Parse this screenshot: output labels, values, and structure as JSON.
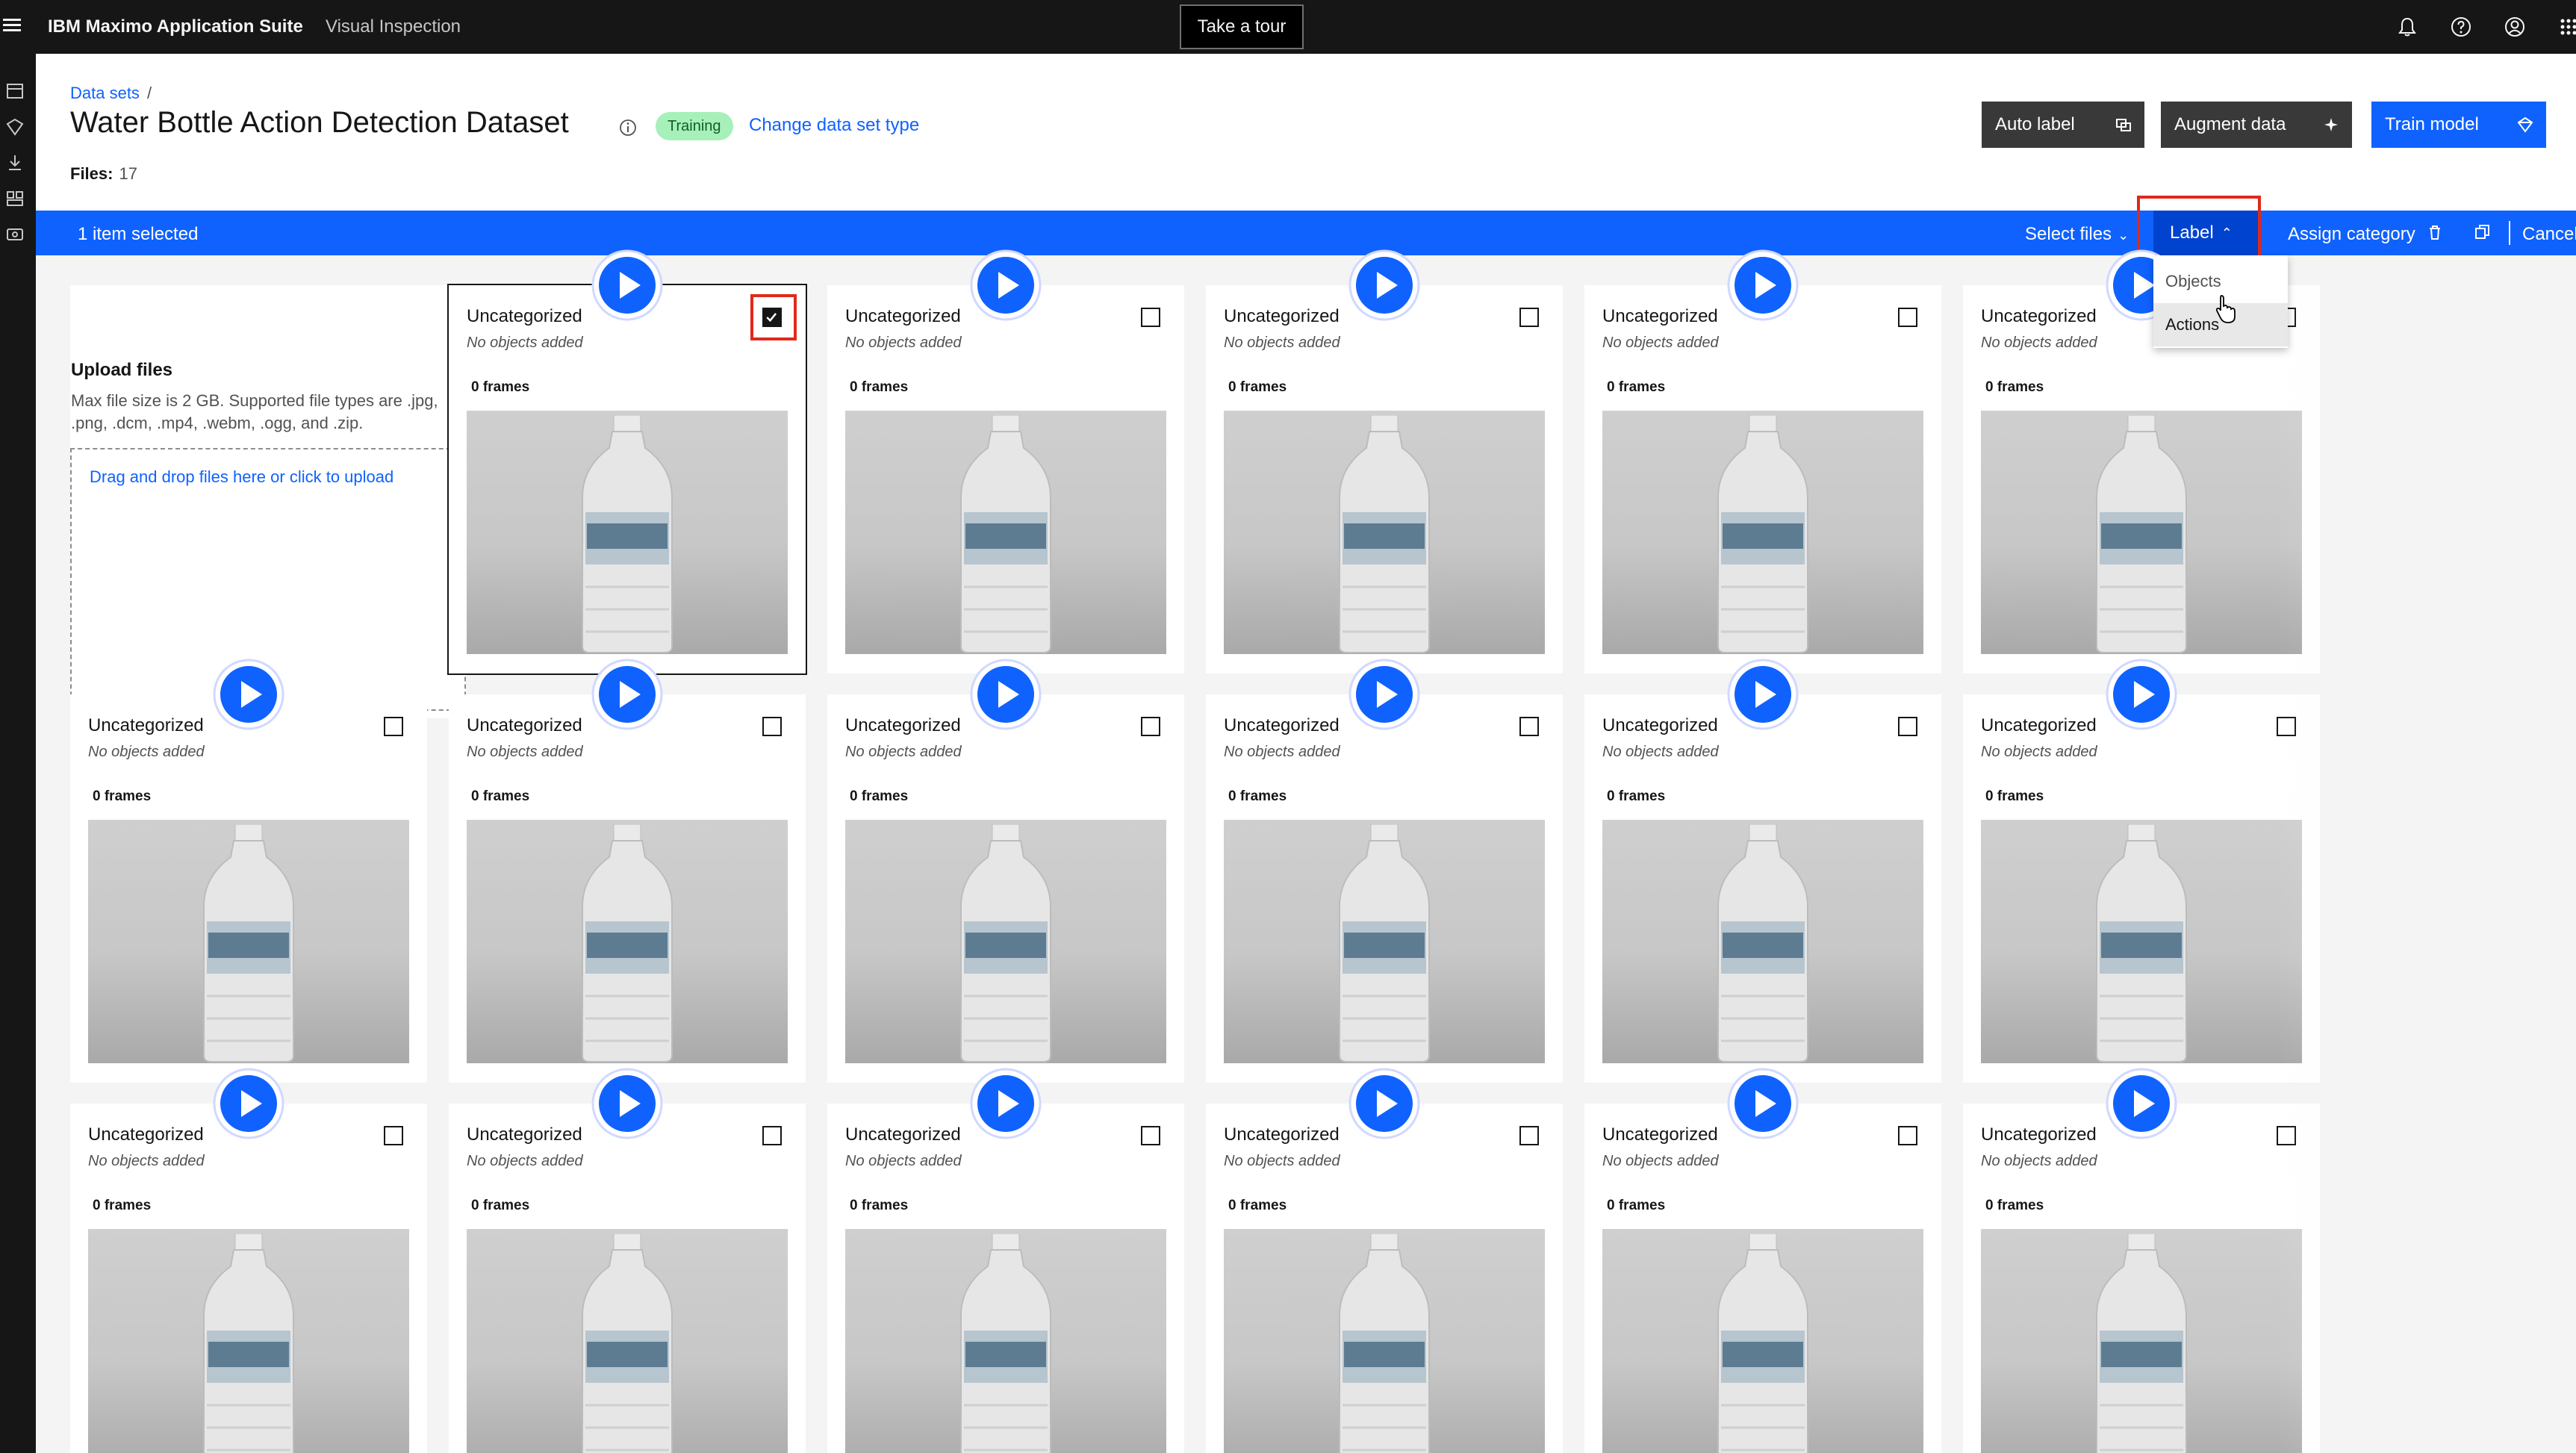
{
  "topbar": {
    "brand": "IBM Maximo Application Suite",
    "product": "Visual Inspection",
    "tour_button": "Take a tour",
    "icons": [
      "notification-icon",
      "help-icon",
      "user-icon",
      "app-switcher-icon"
    ]
  },
  "rail": {
    "icons": [
      "datasets-icon",
      "models-icon",
      "deploy-icon",
      "projects-icon",
      "devices-icon"
    ]
  },
  "header": {
    "breadcrumb_root": "Data sets",
    "breadcrumb_sep": "/",
    "title": "Water Bottle Action Detection Dataset",
    "tag": "Training",
    "change_link": "Change data set type",
    "files_label": "Files:",
    "files_count": "17",
    "auto_label": "Auto label",
    "augment": "Augment data",
    "train": "Train model"
  },
  "selection_bar": {
    "count": "1 item selected",
    "select_files": "Select files",
    "label": "Label",
    "assign_category": "Assign category",
    "cancel": "Cancel"
  },
  "label_menu": {
    "items": [
      "Objects",
      "Actions"
    ],
    "hovered": "Actions"
  },
  "upload": {
    "title": "Upload files",
    "description": "Max file size is 2 GB. Supported file types are .jpg, .png, .dcm, .mp4, .webm, .ogg, and .zip.",
    "dropzone": "Drag and drop files here or click to upload"
  },
  "files": [
    {
      "category": "Uncategorized",
      "objects": "No objects added",
      "frames": "0 frames",
      "selected": true
    },
    {
      "category": "Uncategorized",
      "objects": "No objects added",
      "frames": "0 frames",
      "selected": false
    },
    {
      "category": "Uncategorized",
      "objects": "No objects added",
      "frames": "0 frames",
      "selected": false
    },
    {
      "category": "Uncategorized",
      "objects": "No objects added",
      "frames": "0 frames",
      "selected": false
    },
    {
      "category": "Uncategorized",
      "objects": "No objects added",
      "frames": "0 frames",
      "selected": false
    },
    {
      "category": "Uncategorized",
      "objects": "No objects added",
      "frames": "0 frames",
      "selected": false
    },
    {
      "category": "Uncategorized",
      "objects": "No objects added",
      "frames": "0 frames",
      "selected": false
    },
    {
      "category": "Uncategorized",
      "objects": "No objects added",
      "frames": "0 frames",
      "selected": false
    },
    {
      "category": "Uncategorized",
      "objects": "No objects added",
      "frames": "0 frames",
      "selected": false
    },
    {
      "category": "Uncategorized",
      "objects": "No objects added",
      "frames": "0 frames",
      "selected": false
    },
    {
      "category": "Uncategorized",
      "objects": "No objects added",
      "frames": "0 frames",
      "selected": false
    },
    {
      "category": "Uncategorized",
      "objects": "No objects added",
      "frames": "0 frames",
      "selected": false
    },
    {
      "category": "Uncategorized",
      "objects": "No objects added",
      "frames": "0 frames",
      "selected": false
    },
    {
      "category": "Uncategorized",
      "objects": "No objects added",
      "frames": "0 frames",
      "selected": false
    },
    {
      "category": "Uncategorized",
      "objects": "No objects added",
      "frames": "0 frames",
      "selected": false
    },
    {
      "category": "Uncategorized",
      "objects": "No objects added",
      "frames": "0 frames",
      "selected": false
    },
    {
      "category": "Uncategorized",
      "objects": "No objects added",
      "frames": "0 frames",
      "selected": false
    }
  ],
  "colors": {
    "accent": "#0f62fe",
    "annotation": "#e0291b",
    "tag_bg": "#a7f0ba"
  }
}
